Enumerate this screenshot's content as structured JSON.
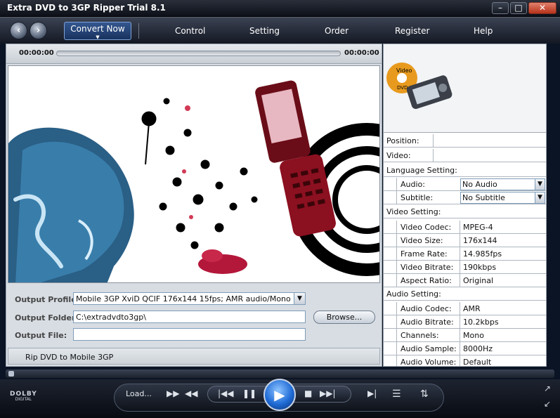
{
  "window": {
    "title": "Extra DVD to 3GP Ripper Trial 8.1"
  },
  "nav": {
    "convert_label": "Convert Now",
    "items": [
      "Control",
      "Setting",
      "Order",
      "Register",
      "Help"
    ]
  },
  "timeline": {
    "start": "00:00:00",
    "end": "00:00:00"
  },
  "form": {
    "output_profile_label": "Output Profile:",
    "output_profile_value": "Mobile 3GP  XviD QCIF 176x144 15fps;  AMR audio/Mono",
    "output_folder_label": "Output Folder:",
    "output_folder_value": "C:\\extradvdto3gp\\",
    "output_file_label": "Output File:",
    "output_file_value": "",
    "browse_label": "Browse..."
  },
  "status": {
    "text": "Rip DVD to Mobile 3GP"
  },
  "info": {
    "position_label": "Position:",
    "video_label": "Video:",
    "language_section": "Language Setting:",
    "audio_label": "Audio:",
    "audio_value": "No Audio",
    "subtitle_label": "Subtitle:",
    "subtitle_value": "No Subtitle",
    "video_section": "Video Setting:",
    "video_rows": [
      {
        "label": "Video Codec:",
        "value": "MPEG-4"
      },
      {
        "label": "Video Size:",
        "value": "176x144"
      },
      {
        "label": "Frame Rate:",
        "value": "14.985fps"
      },
      {
        "label": "Video Bitrate:",
        "value": "190kbps"
      },
      {
        "label": "Aspect Ratio:",
        "value": "Original"
      }
    ],
    "audio_section": "Audio Setting:",
    "audio_rows": [
      {
        "label": "Audio Codec:",
        "value": "AMR"
      },
      {
        "label": "Audio Bitrate:",
        "value": "10.2kbps"
      },
      {
        "label": "Channels:",
        "value": "Mono"
      },
      {
        "label": "Audio Sample:",
        "value": "8000Hz"
      },
      {
        "label": "Audio Volume:",
        "value": "Default"
      }
    ]
  },
  "logo": {
    "disc_text": "Video",
    "disc_sub": "DVD"
  },
  "player": {
    "load_label": "Load...",
    "dolby_top": "DOLBY",
    "dolby_bottom": "DIGITAL",
    "icons": [
      "fast-forward-icon",
      "rewind-icon",
      "skip-back-icon",
      "pause-icon",
      "play-icon",
      "stop-icon",
      "skip-forward-icon",
      "step-icon",
      "list-icon",
      "snapshot-icon",
      "expand-icon",
      "shrink-icon"
    ]
  },
  "colors": {
    "accent": "#1f6bd6",
    "panel": "#d8dde3",
    "nav_active": "#34578f"
  }
}
